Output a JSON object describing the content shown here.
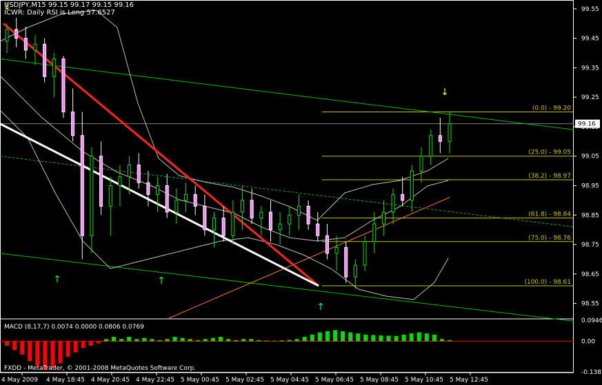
{
  "header": {
    "symbol_line": "USDJPY,M15  99.15 99.17 99.15 99.16",
    "indicator_line": "ICWR: Daily RSI is Long 57.6527"
  },
  "chart_data": {
    "type": "candlestick",
    "symbol": "USDJPY",
    "timeframe": "M15",
    "ohlc_shown": {
      "open": 99.15,
      "high": 99.17,
      "low": 99.15,
      "close": 99.16
    },
    "current_price": "99.16",
    "y_axis": {
      "min": 98.5,
      "max": 99.58,
      "ticks": [
        "99.55",
        "99.45",
        "99.35",
        "99.25",
        "99.15",
        "99.05",
        "98.95",
        "98.85",
        "98.75",
        "98.65",
        "98.55"
      ]
    },
    "x_axis": {
      "ticks": [
        "4 May 2009",
        "4 May 18:45",
        "4 May 20:45",
        "4 May 22:45",
        "5 May 00:45",
        "5 May 02:45",
        "5 May 04:45",
        "5 May 06:45",
        "5 May 08:45",
        "5 May 10:45",
        "5 May 12:45"
      ]
    },
    "fibonacci": [
      {
        "label": "(0.0) - 99.20",
        "price": 99.2
      },
      {
        "label": "(25.0) - 99.05",
        "price": 99.05
      },
      {
        "label": "(38.2) - 98.97",
        "price": 98.97
      },
      {
        "label": "(61.8) - 98.84",
        "price": 98.84
      },
      {
        "label": "(75.0) - 98.76",
        "price": 98.76
      },
      {
        "label": "(100.0) - 98.61",
        "price": 98.61
      }
    ],
    "candles": [
      [
        99.44,
        99.5,
        99.4,
        99.48
      ],
      [
        99.48,
        99.52,
        99.42,
        99.45
      ],
      [
        99.45,
        99.49,
        99.38,
        99.41
      ],
      [
        99.41,
        99.46,
        99.36,
        99.43
      ],
      [
        99.43,
        99.45,
        99.3,
        99.32
      ],
      [
        99.32,
        99.4,
        99.25,
        99.38
      ],
      [
        99.38,
        99.39,
        99.18,
        99.2
      ],
      [
        99.2,
        99.28,
        99.1,
        99.12
      ],
      [
        99.12,
        99.2,
        98.7,
        98.78
      ],
      [
        98.78,
        99.08,
        98.72,
        99.05
      ],
      [
        99.05,
        99.1,
        98.85,
        98.88
      ],
      [
        98.88,
        98.98,
        98.78,
        98.95
      ],
      [
        98.95,
        99.02,
        98.88,
        98.98
      ],
      [
        98.98,
        99.05,
        98.92,
        99.02
      ],
      [
        99.02,
        99.06,
        98.94,
        98.96
      ],
      [
        98.96,
        99.0,
        98.88,
        98.92
      ],
      [
        98.92,
        98.98,
        98.86,
        98.95
      ],
      [
        98.95,
        98.99,
        98.84,
        98.86
      ],
      [
        98.86,
        98.94,
        98.82,
        98.9
      ],
      [
        98.9,
        98.96,
        98.86,
        98.92
      ],
      [
        98.92,
        98.95,
        98.85,
        98.88
      ],
      [
        98.88,
        98.92,
        98.78,
        98.8
      ],
      [
        98.8,
        98.86,
        98.74,
        98.84
      ],
      [
        98.84,
        98.88,
        98.76,
        98.78
      ],
      [
        98.78,
        98.9,
        98.75,
        98.86
      ],
      [
        98.86,
        98.95,
        98.8,
        98.9
      ],
      [
        98.9,
        98.94,
        98.82,
        98.84
      ],
      [
        98.84,
        98.88,
        98.78,
        98.86
      ],
      [
        98.86,
        98.9,
        98.76,
        98.8
      ],
      [
        98.8,
        98.86,
        98.75,
        98.82
      ],
      [
        98.82,
        98.88,
        98.78,
        98.85
      ],
      [
        98.85,
        98.92,
        98.8,
        98.88
      ],
      [
        98.88,
        98.9,
        98.8,
        98.82
      ],
      [
        98.82,
        98.86,
        98.76,
        98.78
      ],
      [
        98.78,
        98.82,
        98.7,
        98.72
      ],
      [
        98.72,
        98.78,
        98.66,
        98.74
      ],
      [
        98.74,
        98.76,
        98.62,
        98.64
      ],
      [
        98.64,
        98.7,
        98.6,
        98.68
      ],
      [
        98.68,
        98.78,
        98.66,
        98.76
      ],
      [
        98.76,
        98.86,
        98.72,
        98.82
      ],
      [
        98.82,
        98.9,
        98.78,
        98.86
      ],
      [
        98.86,
        98.94,
        98.82,
        98.92
      ],
      [
        98.92,
        98.98,
        98.88,
        98.9
      ],
      [
        98.9,
        99.02,
        98.86,
        99.0
      ],
      [
        99.0,
        99.08,
        98.96,
        99.05
      ],
      [
        99.05,
        99.14,
        99.02,
        99.12
      ],
      [
        99.12,
        99.18,
        99.06,
        99.1
      ],
      [
        99.1,
        99.2,
        99.06,
        99.16
      ]
    ],
    "macd": {
      "label": "MACD  (8,17,7) 0.0074 0.0000 0.0806 0.0769",
      "ticks": [
        "0.0946",
        "0.00",
        "-0.1383"
      ],
      "range": [
        -0.1383,
        0.0946
      ],
      "histogram": [
        -0.02,
        -0.04,
        -0.06,
        -0.09,
        -0.11,
        -0.13,
        -0.12,
        -0.1,
        -0.07,
        -0.05,
        -0.03,
        -0.02,
        -0.01,
        0.01,
        0.02,
        0.01,
        0.02,
        0.01,
        0.015,
        0.01,
        0.005,
        0.01,
        0.02,
        0.015,
        0.01,
        0.005,
        0.01,
        0.015,
        0.02,
        0.01,
        0.005,
        0.01,
        0.01,
        0.005,
        0.003,
        0.002,
        0.004,
        0.006,
        0.01,
        0.02,
        0.03,
        0.04,
        0.045,
        0.05,
        0.045,
        0.04,
        0.035,
        0.03,
        0.028,
        0.026,
        0.025,
        0.024,
        0.03,
        0.035,
        0.04,
        0.035,
        0.03,
        0.01,
        0.005
      ]
    }
  },
  "footer": {
    "copyright": "FXDD - MetaTrader, © 2001-2008 MetaQuotes Software Corp."
  },
  "colors": {
    "bull": "#00e000",
    "bear": "#ffffff",
    "bear_body": "#ff80ff",
    "fib": "#c8c800",
    "trend_red": "#ff2020",
    "trend_white": "#ffffff",
    "channel": "#00c000",
    "bands": "#c0c0c0",
    "orange": "#ff8020",
    "macd_red": "#ff0000"
  }
}
